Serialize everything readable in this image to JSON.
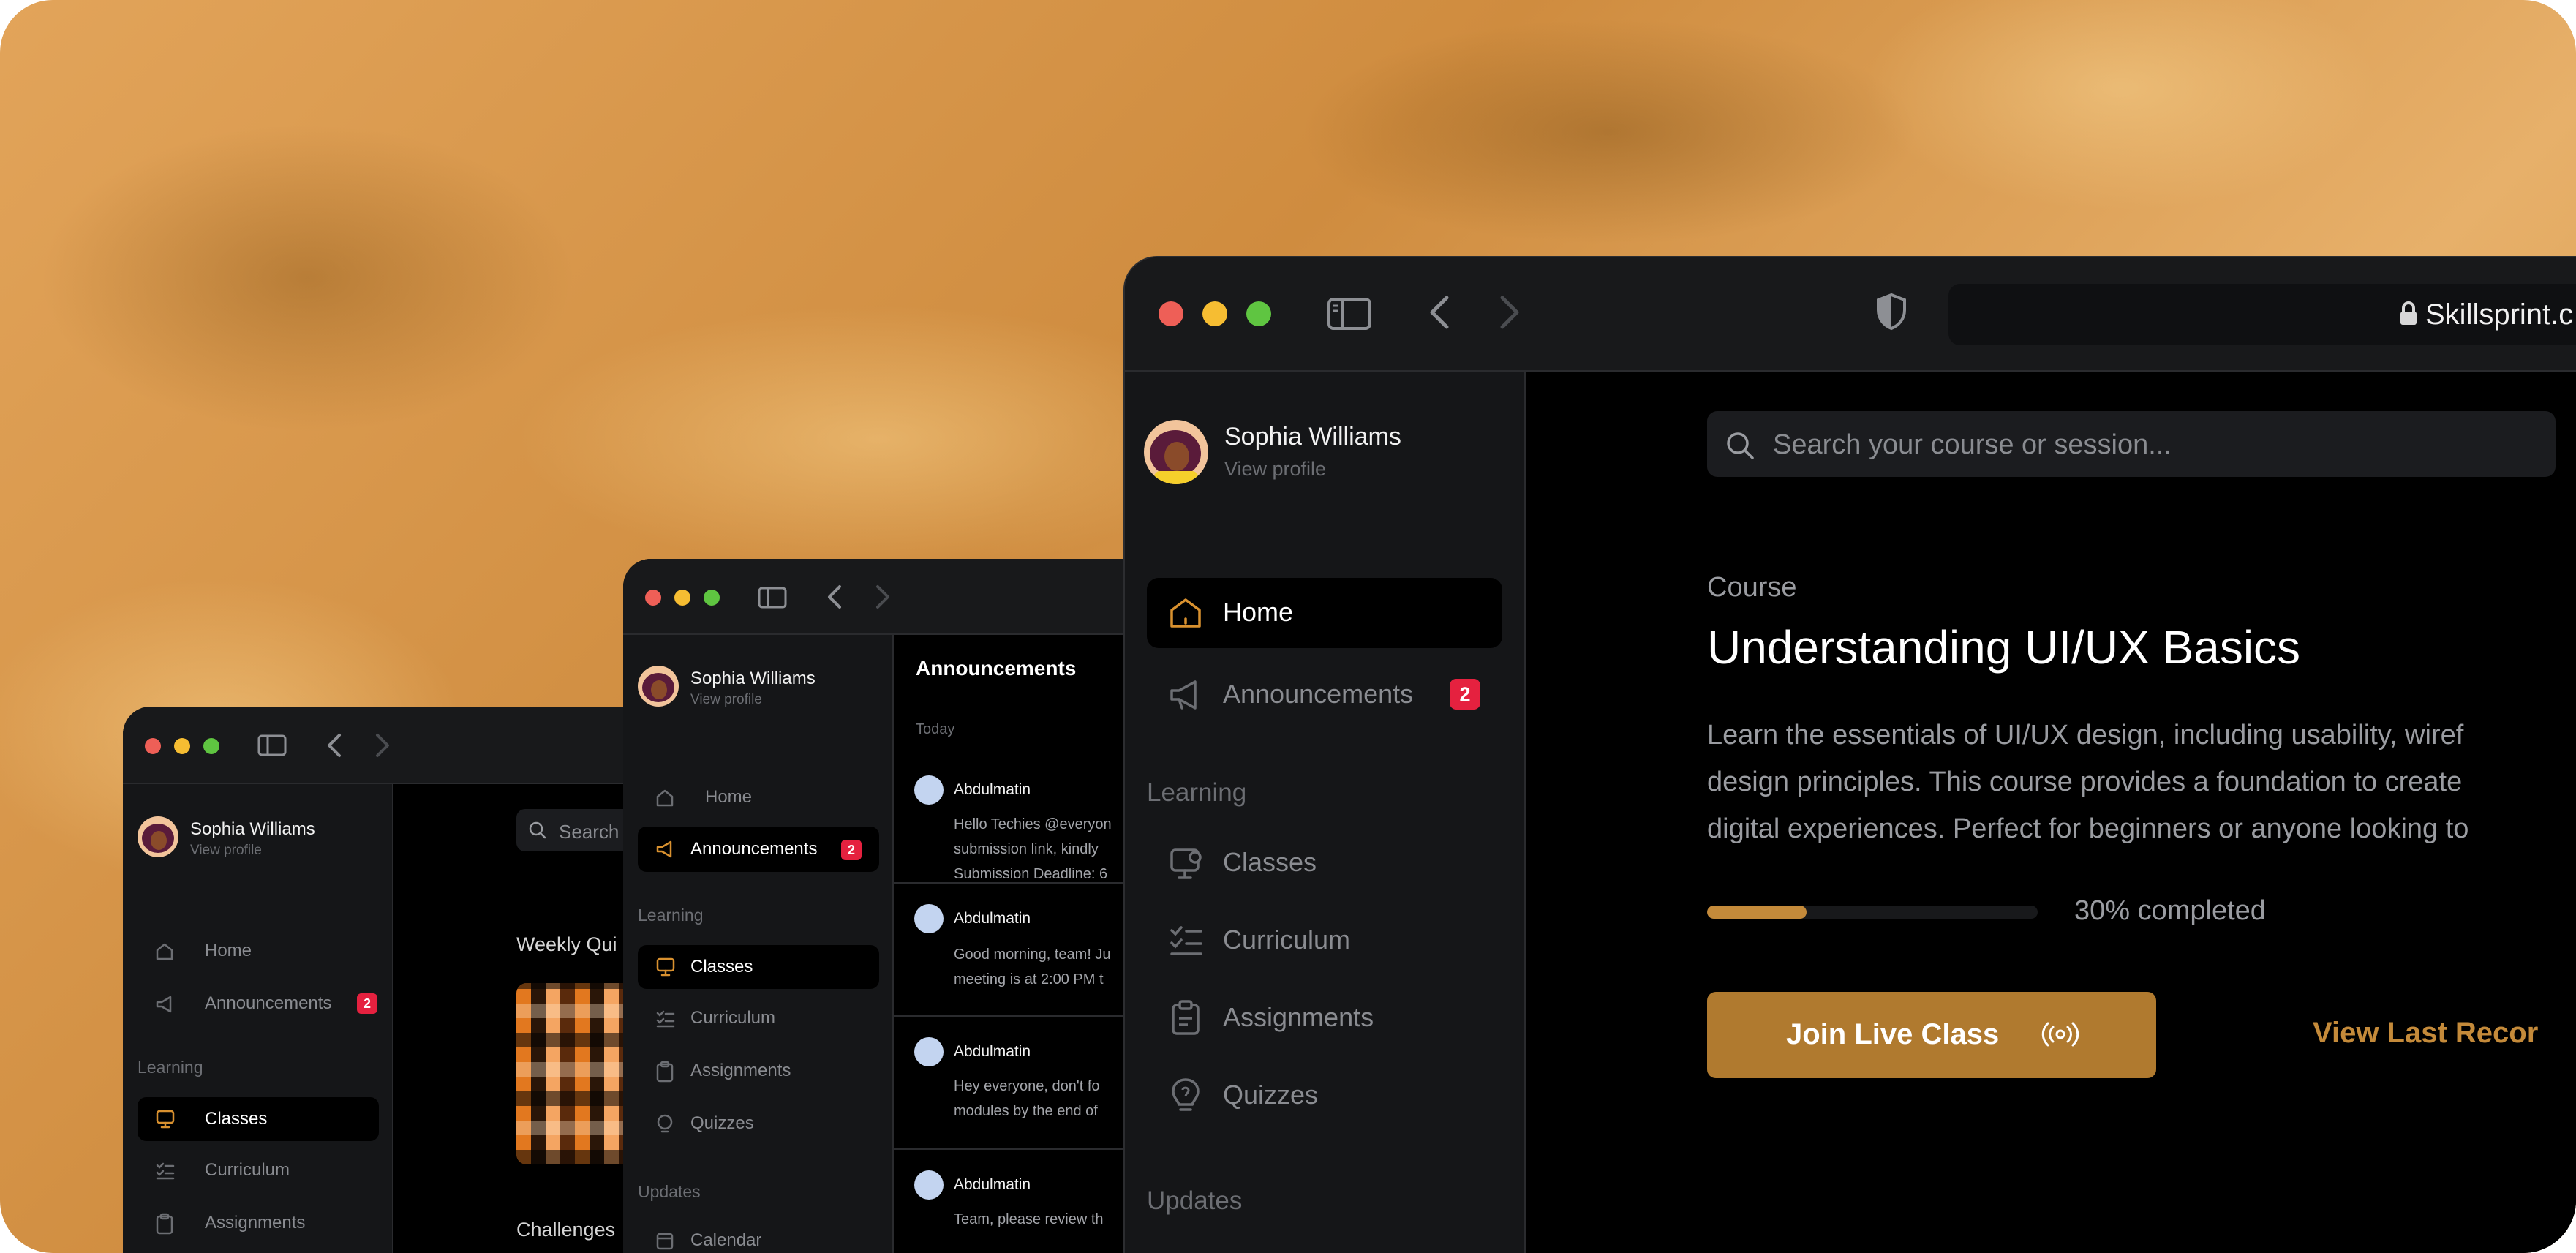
{
  "profile": {
    "name": "Sophia Williams",
    "link": "View profile"
  },
  "nav": {
    "home": "Home",
    "announcements": "Announcements",
    "announcements_badge": "2",
    "section_learning": "Learning",
    "classes": "Classes",
    "curriculum": "Curriculum",
    "assignments": "Assignments",
    "quizzes": "Quizzes",
    "section_updates": "Updates",
    "calendar": "Calendar"
  },
  "browser": {
    "url": "Skillsprint.c"
  },
  "search": {
    "placeholder_large": "Search your course or session...",
    "placeholder_small": "Search"
  },
  "course": {
    "eyebrow": "Course",
    "title": "Understanding UI/UX Basics",
    "desc_line1": "Learn the essentials of UI/UX design, including usability, wiref",
    "desc_line2": "design principles. This course provides a foundation to create",
    "desc_line3": "digital experiences. Perfect for beginners or anyone looking to",
    "progress_percent": 30,
    "progress_label": "30% completed",
    "join_button": "Join Live Class",
    "view_button": "View Last Recor"
  },
  "announcements_panel": {
    "title": "Announcements",
    "group": "Today",
    "items": [
      {
        "author": "Abdulmatin",
        "lines": [
          "Hello Techies @everyon",
          "submission link, kindly",
          "Submission Deadline: 6"
        ]
      },
      {
        "author": "Abdulmatin",
        "lines": [
          "Good morning, team! Ju",
          "meeting is at 2:00 PM t"
        ]
      },
      {
        "author": "Abdulmatin",
        "lines": [
          "Hey everyone, don't fo",
          "modules by the end of"
        ]
      },
      {
        "author": "Abdulmatin",
        "lines": [
          "Team, please review th"
        ]
      }
    ]
  },
  "small_window": {
    "weekly_quiz": "Weekly Qui",
    "challenges": "Challenges"
  },
  "colors": {
    "accent": "#b07a2f",
    "badge": "#e5213f",
    "background": "#000000",
    "sidebar": "#151618"
  }
}
